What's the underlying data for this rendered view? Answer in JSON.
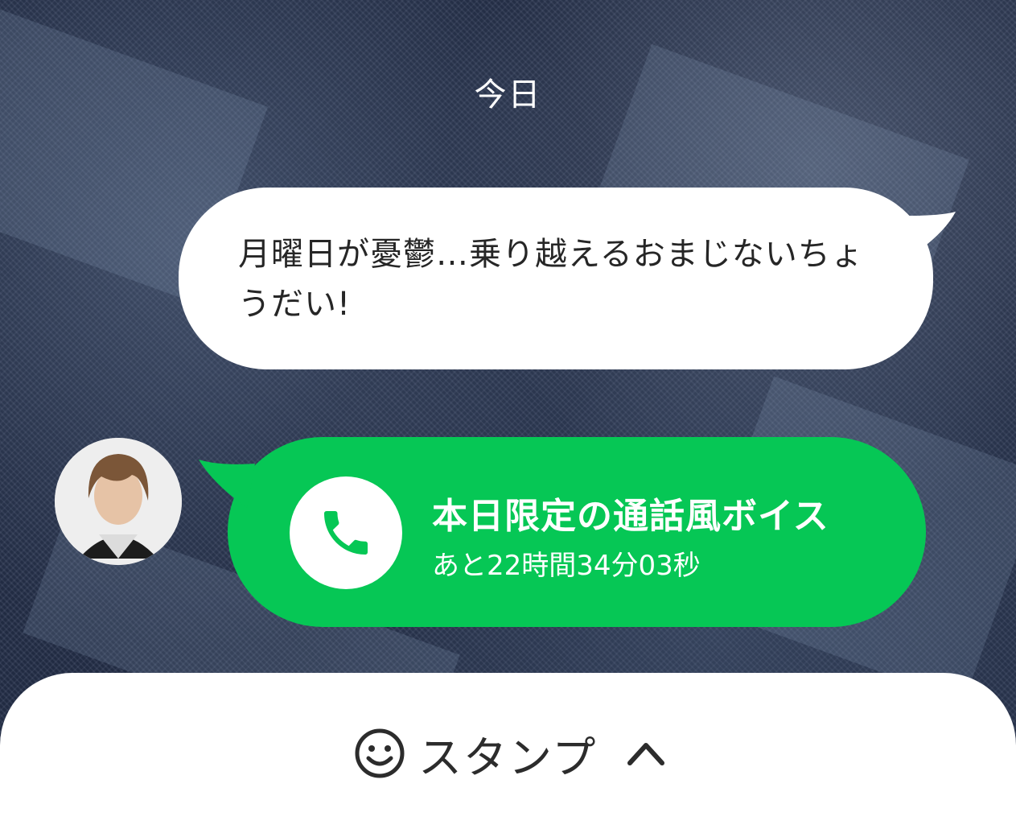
{
  "chat": {
    "date_label": "今日",
    "messages": [
      {
        "side": "right",
        "text": "月曜日が憂鬱…乗り越えるおまじないちょうだい!"
      },
      {
        "side": "left",
        "type": "voice_call",
        "title": "本日限定の通話風ボイス",
        "subtitle": "あと22時間34分03秒",
        "icon": "phone-icon",
        "color": "#06c755"
      }
    ]
  },
  "bottom_bar": {
    "stamp_label": "スタンプ",
    "stamp_icon": "smiley-icon",
    "toggle_icon": "chevron-up-icon"
  },
  "colors": {
    "bubble_green": "#06c755",
    "bubble_white": "#ffffff",
    "background": "#25304a"
  }
}
